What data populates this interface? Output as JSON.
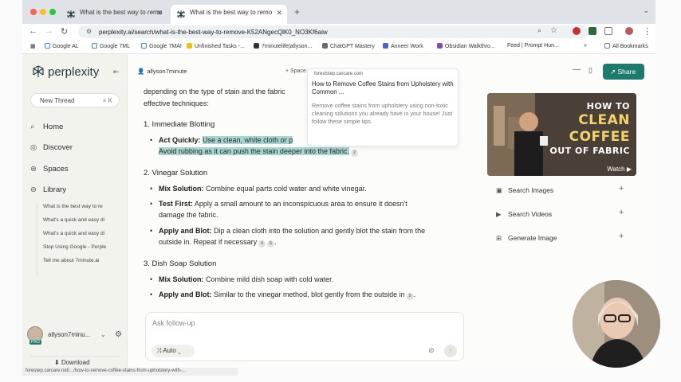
{
  "browser": {
    "tabs": [
      {
        "label": "What is the best way to remo",
        "active": false
      },
      {
        "label": "What is the best way to remo",
        "active": true
      }
    ],
    "url": "perplexity.ai/search/what-is-the-best-way-to-remove-K52ANgecQlK0_NO3Kf6aiw",
    "bookmarks": [
      {
        "label": "Google AL",
        "color": "#ffffff"
      },
      {
        "label": "Google 7ML",
        "color": "#ffffff"
      },
      {
        "label": "Google 7MAI",
        "color": "#ffffff"
      },
      {
        "label": "Unfinished Tasks -...",
        "color": "#f2c200"
      },
      {
        "label": "7minutelife|allyson...",
        "color": "#333333"
      },
      {
        "label": "ChatGPT Mastery",
        "color": "#6a6a6a"
      },
      {
        "label": "Anneer Work",
        "color": "#4466cc"
      },
      {
        "label": "Obsidian Walkthro...",
        "color": "#7a4fb5"
      },
      {
        "label": "Feed | Prompt Hun...",
        "color": "#dddddd"
      },
      {
        "label": "All Bookmarks",
        "color": "#888888"
      }
    ]
  },
  "sidebar": {
    "logo": "perplexity",
    "new_thread": "New Thread",
    "new_thread_kbd": "× K",
    "nav": [
      {
        "label": "Home",
        "icon": "search-icon"
      },
      {
        "label": "Discover",
        "icon": "compass-icon"
      },
      {
        "label": "Spaces",
        "icon": "spaces-icon"
      },
      {
        "label": "Library",
        "icon": "library-icon"
      }
    ],
    "library": [
      "What is the best way to re",
      "What's a quick and easy di",
      "What's a quick and easy di",
      "Stop Using Google - Perple",
      "Tell me about 7minute.ai"
    ],
    "user": "allyson7minu...",
    "pro_badge": "PRO",
    "download": "Download"
  },
  "header": {
    "author": "allyson7minute",
    "space": "+ Space"
  },
  "answer": {
    "intro_1": "depending on the type of stain and the fabric",
    "intro_2": "effective techniques:",
    "sections": [
      {
        "heading": "1. Immediate Blotting",
        "bullets": [
          {
            "bold": "Act Quickly:",
            "text": "Use a clean, white cloth or p",
            "cont": "Avoid rubbing as it can push the stain deeper into the fabric.",
            "cite": "2"
          }
        ]
      },
      {
        "heading": "2. Vinegar Solution",
        "bullets": [
          {
            "bold": "Mix Solution:",
            "text": "Combine equal parts cold water and white vinegar."
          },
          {
            "bold": "Test First:",
            "text": "Apply a small amount to an inconspicuous area to ensure it doesn't",
            "cont": "damage the fabric."
          },
          {
            "bold": "Apply and Blot:",
            "text": "Dip a clean cloth into the solution and gently blot the stain from the",
            "cont": "outside in. Repeat if necessary",
            "cite": "4",
            "cite2": "5"
          }
        ]
      },
      {
        "heading": "3. Dish Soap Solution",
        "bullets": [
          {
            "bold": "Mix Solution:",
            "text": "Combine mild dish soap with cold water."
          },
          {
            "bold": "Apply and Blot:",
            "text": "Similar to the vinegar method, blot gently from the outside in",
            "cite": "5"
          }
        ]
      }
    ]
  },
  "popup": {
    "source": "foreststep.carcare.com",
    "title": "How to Remove Coffee Stains from Upholstery with Common ...",
    "desc": "Remove coffee stains from upholstery using non-toxic cleaning solutions you already have in your house! Just follow these simple tips."
  },
  "followup": {
    "placeholder": "Ask follow-up",
    "mode": "Auto"
  },
  "right_panel": {
    "video_title_1": "HOW TO",
    "video_title_2": "CLEAN",
    "video_title_3": "COFFEE",
    "video_title_4": "OUT OF FABRIC",
    "watch": "Watch",
    "actions": [
      {
        "label": "Search Images",
        "icon": "image-icon"
      },
      {
        "label": "Search Videos",
        "icon": "video-icon"
      },
      {
        "label": "Generate Image",
        "icon": "generate-image-icon"
      }
    ]
  },
  "status_bar": "forestep.carcare.net/.../how-to-remove-coffee-stains-from-upholstery-with-...",
  "colors": {
    "accent": "#1d7a6d",
    "highlight": "#a7d6cf"
  }
}
